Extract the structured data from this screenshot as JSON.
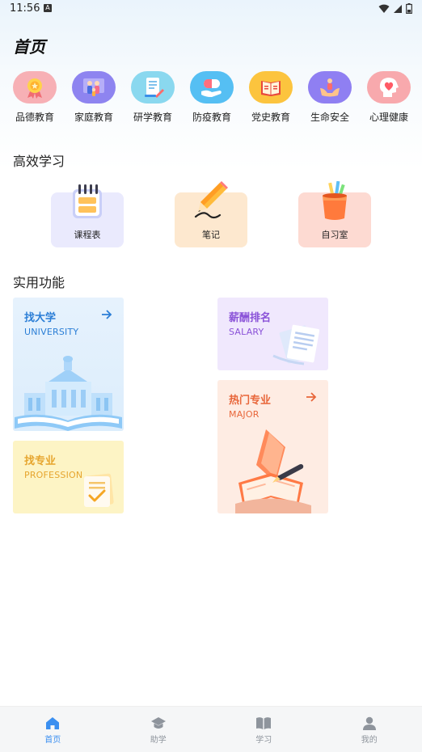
{
  "status": {
    "time": "11:56",
    "badge": "A"
  },
  "page": {
    "title": "首页"
  },
  "categories": [
    {
      "label": "品德教育",
      "icon": "medal-icon",
      "color": "#f7a8b0"
    },
    {
      "label": "家庭教育",
      "icon": "family-icon",
      "color": "#8e84f0"
    },
    {
      "label": "研学教育",
      "icon": "study-report-icon",
      "color": "#7fd6ee"
    },
    {
      "label": "防疫教育",
      "icon": "medicine-icon",
      "color": "#4fb8f2"
    },
    {
      "label": "党史教育",
      "icon": "book-icon",
      "color": "#fbbf3a"
    },
    {
      "label": "生命安全",
      "icon": "safety-hands-icon",
      "color": "#8f7ff2"
    },
    {
      "label": "心理健康",
      "icon": "heart-mind-icon",
      "color": "#f7a3a6"
    }
  ],
  "study": {
    "title": "高效学习",
    "items": [
      {
        "label": "课程表",
        "icon": "calendar-icon"
      },
      {
        "label": "笔记",
        "icon": "pencil-icon"
      },
      {
        "label": "自习室",
        "icon": "pencil-cup-icon"
      }
    ]
  },
  "tools": {
    "title": "实用功能",
    "university": {
      "title": "找大学",
      "subtitle": "UNIVERSITY",
      "icon": "arrow-right-icon"
    },
    "salary": {
      "title": "薪酬排名",
      "subtitle": "SALARY"
    },
    "major": {
      "title": "热门专业",
      "subtitle": "MAJOR",
      "icon": "arrow-right-icon"
    },
    "profession": {
      "title": "找专业",
      "subtitle": "PROFESSION"
    }
  },
  "nav": [
    {
      "label": "首页",
      "icon": "home-icon",
      "active": true
    },
    {
      "label": "助学",
      "icon": "graduation-cap-icon",
      "active": false
    },
    {
      "label": "学习",
      "icon": "open-book-icon",
      "active": false
    },
    {
      "label": "我的",
      "icon": "user-icon",
      "active": false
    }
  ],
  "colors": {
    "accent": "#3b8ff0",
    "inactive": "#8e949c"
  }
}
